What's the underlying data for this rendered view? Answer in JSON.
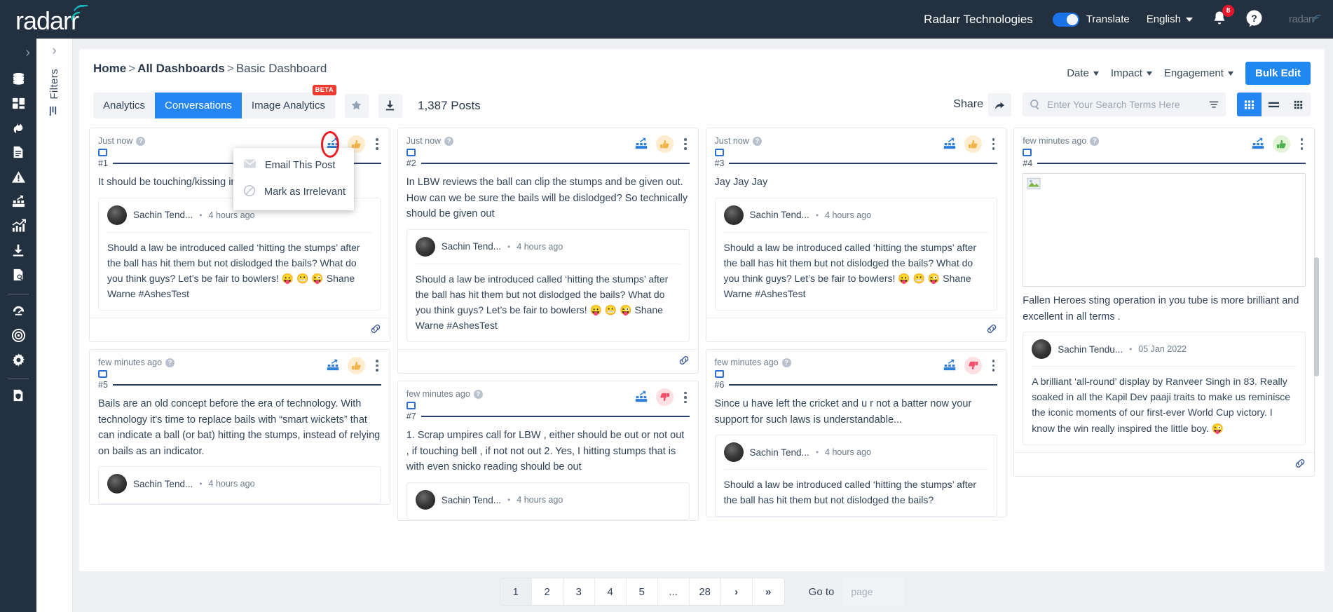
{
  "topbar": {
    "logo_text": "radarr",
    "org_name": "Radarr Technologies",
    "translate_label": "Translate",
    "language": "English",
    "notification_count": "8",
    "corner_logo_text": "radarr"
  },
  "rail": {
    "expand_label": "›",
    "items": [
      {
        "name": "database-icon",
        "label": "Data Sources"
      },
      {
        "name": "dashboard-icon",
        "label": "Dashboards"
      },
      {
        "name": "trending-icon",
        "label": "Trending"
      },
      {
        "name": "document-icon",
        "label": "Reports"
      },
      {
        "name": "alert-icon",
        "label": "Alerts"
      },
      {
        "name": "influencer-icon",
        "label": "Influencers"
      },
      {
        "name": "analytics-chart-icon",
        "label": "Analytics"
      },
      {
        "name": "download-icon",
        "label": "Downloads"
      },
      {
        "name": "search-archive-icon",
        "label": "Archive Search"
      },
      {
        "name": "gauge-icon",
        "label": "Performance"
      },
      {
        "name": "target-icon",
        "label": "Targets"
      },
      {
        "name": "gear-icon",
        "label": "Settings"
      },
      {
        "name": "shield-doc-icon",
        "label": "Compliance"
      }
    ]
  },
  "filters_panel": {
    "label": "Filters",
    "chevron": "›"
  },
  "breadcrumb": {
    "home": "Home",
    "sep": ">",
    "all_dashboards": "All Dashboards",
    "current": "Basic Dashboard"
  },
  "right_filters": {
    "date": "Date",
    "impact": "Impact",
    "engagement": "Engagement",
    "bulk_edit": "Bulk Edit"
  },
  "tabs": [
    {
      "label": "Analytics",
      "active": false,
      "badge": ""
    },
    {
      "label": "Conversations",
      "active": true,
      "badge": ""
    },
    {
      "label": "Image Analytics",
      "active": false,
      "badge": "BETA"
    }
  ],
  "toolbar": {
    "star_icon": "star-icon",
    "download_icon": "download-icon",
    "post_count": "1,387 Posts",
    "share_label": "Share",
    "search_placeholder": "Enter Your Search Terms Here",
    "search_value": "",
    "views": [
      "grid-view",
      "list-view",
      "compact-view"
    ]
  },
  "menu": {
    "items": [
      {
        "label": "Email This Post",
        "icon": "envelope-icon"
      },
      {
        "label": "Mark as Irrelevant",
        "icon": "block-icon"
      }
    ]
  },
  "cards": [
    {
      "id": "1",
      "time": "Just now",
      "rank": "#1",
      "sentiment": "neutral",
      "text": "It should be touching/kissing instead",
      "image": false,
      "quote": {
        "author": "Sachin Tend...",
        "time": "4 hours ago",
        "body": "Should a law be introduced called ‘hitting the stumps’ after the ball has hit them but not dislodged the bails? What do you think guys? Let’s be fair to bowlers! 😛 😬 😜 Shane Warne #AshesTest"
      },
      "link": true
    },
    {
      "id": "2",
      "time": "Just now",
      "rank": "#2",
      "sentiment": "neutral",
      "text": "In LBW reviews the ball can clip the stumps and be given out. How can we be sure the bails will be dislodged? So technically should be given out",
      "image": false,
      "quote": {
        "author": "Sachin Tend...",
        "time": "4 hours ago",
        "body": "Should a law be introduced called ‘hitting the stumps’ after the ball has hit them but not dislodged the bails? What do you think guys? Let’s be fair to bowlers! 😛 😬 😜 Shane Warne #AshesTest"
      },
      "link": true
    },
    {
      "id": "3",
      "time": "Just now",
      "rank": "#3",
      "sentiment": "neutral",
      "text": "Jay Jay Jay",
      "image": false,
      "quote": {
        "author": "Sachin Tend...",
        "time": "4 hours ago",
        "body": "Should a law be introduced called ‘hitting the stumps’ after the ball has hit them but not dislodged the bails? What do you think guys? Let’s be fair to bowlers! 😛 😬 😜 Shane Warne #AshesTest"
      },
      "link": true
    },
    {
      "id": "4",
      "time": "few minutes ago",
      "rank": "#4",
      "sentiment": "positive",
      "text": "Fallen Heroes sting operation in you tube is more brilliant and excellent in all terms .",
      "image": true,
      "quote": {
        "author": "Sachin Tendu...",
        "time": "05 Jan 2022",
        "body": "A brilliant ‘all-round’ display by Ranveer Singh in 83. Really soaked in all the Kapil Dev paaji traits to make us reminisce the iconic moments of our first-ever World Cup victory. I know the win really inspired the little boy. 😜"
      },
      "link": true
    },
    {
      "id": "5",
      "time": "few minutes ago",
      "rank": "#5",
      "sentiment": "neutral",
      "text": "Bails are an old concept before the era of technology. With technology it's time to replace bails with “smart wickets” that can indicate a ball (or bat) hitting the stumps, instead of relying on bails as an indicator.",
      "image": false,
      "quote": {
        "author": "Sachin Tend...",
        "time": "4 hours ago",
        "body": ""
      },
      "link": false
    },
    {
      "id": "6",
      "time": "few minutes ago",
      "rank": "#6",
      "sentiment": "negative",
      "text": "Since u have left the cricket and u r not a batter now your support for such laws is understandable...",
      "image": false,
      "quote": {
        "author": "Sachin Tend...",
        "time": "4 hours ago",
        "body": "Should a law be introduced called ‘hitting the stumps’ after the ball has hit them but not dislodged the bails?"
      },
      "link": false
    },
    {
      "id": "7",
      "time": "few minutes ago",
      "rank": "#7",
      "sentiment": "negative",
      "text": "1. Scrap umpires call for LBW , either should be out or not out , if touching bell , if not not out 2. Yes, I hitting stumps that is with even snicko reading should be out",
      "image": false,
      "quote": {
        "author": "Sachin Tend...",
        "time": "4 hours ago",
        "body": ""
      },
      "link": false
    }
  ],
  "pagination": {
    "pages": [
      "1",
      "2",
      "3",
      "4",
      "5",
      "...",
      "28"
    ],
    "active_page": "1",
    "next_label": "›",
    "last_label": "»",
    "goto_label": "Go to",
    "goto_placeholder": "page"
  },
  "colors": {
    "accent_blue": "#2485f3",
    "dark_navy": "#22303f",
    "badge_red": "#ef3b2f",
    "positive_green": "#4caf50",
    "negative_red": "#f4506b",
    "neutral_orange": "#f5b041"
  }
}
